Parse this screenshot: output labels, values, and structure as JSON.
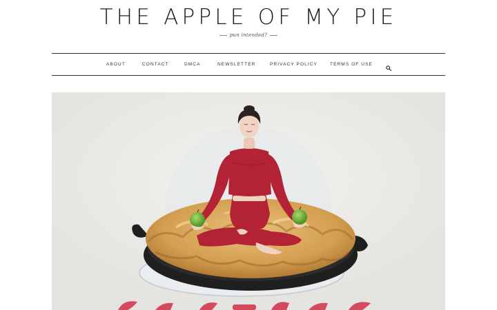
{
  "site": {
    "title": "THE APPLE OF MY PIE",
    "tagline": "pun intended?"
  },
  "nav": {
    "items": [
      {
        "label": "ABOUT"
      },
      {
        "label": "CONTACT"
      },
      {
        "label": "DMCA"
      },
      {
        "label": "NEWSLETTER"
      },
      {
        "label": "PRIVACY POLICY"
      },
      {
        "label": "TERMS OF USE"
      }
    ],
    "search_icon": "search-icon"
  },
  "hero": {
    "description_icon": "painted-woman-meditating-on-apple-pie",
    "colors": {
      "background": "#ecebe8",
      "outfit": "#b42335",
      "crust": "#d8a85a",
      "pan": "#1f1f1f",
      "apple": "#6fb43a",
      "banner_text": "#d23a4f"
    }
  }
}
